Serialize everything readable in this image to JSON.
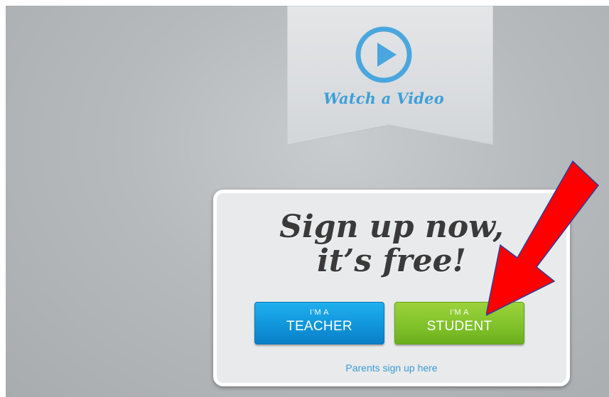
{
  "banner": {
    "video_label": "Watch a Video"
  },
  "signup": {
    "headline_line1": "Sign up now,",
    "headline_line2": "it’s free!",
    "teacher_button": {
      "prefix": "I’M A",
      "label": "TEACHER"
    },
    "student_button": {
      "prefix": "I’M A",
      "label": "STUDENT"
    },
    "parents_link": "Parents sign up here"
  },
  "colors": {
    "accent_blue": "#3f9fd8",
    "teacher_button": "#0f93d9",
    "student_button": "#7fc12a",
    "arrow": "#ff0000",
    "headline": "#3a3a3a"
  },
  "icons": {
    "video": "play-circle-icon",
    "annotation": "red-arrow-icon"
  }
}
